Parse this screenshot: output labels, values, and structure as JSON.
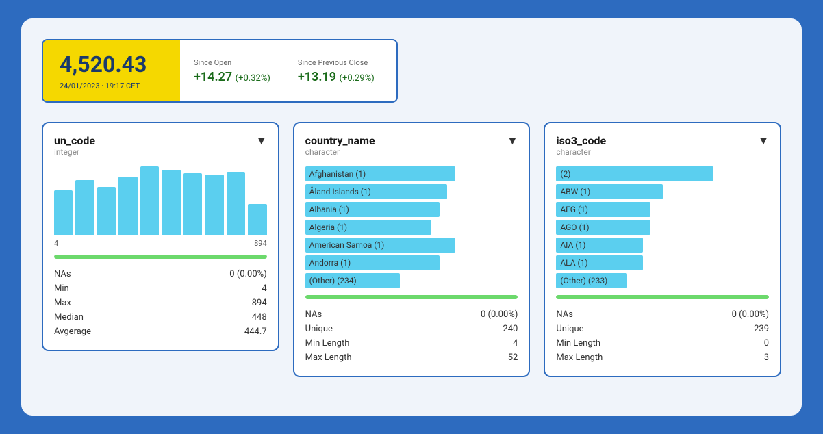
{
  "ticker": {
    "main_value": "4,520.43",
    "date": "24/01/2023 · 19:17 CET",
    "since_open_label": "Since Open",
    "since_open_value": "+14.27",
    "since_open_pct": "(+0.32%)",
    "since_prev_label": "Since Previous Close",
    "since_prev_value": "+13.19",
    "since_prev_pct": "(+0.29%)"
  },
  "card_un_code": {
    "title": "un_code",
    "subtitle": "integer",
    "chevron": "▼",
    "chart_min": "4",
    "chart_max": "894",
    "bars": [
      65,
      80,
      70,
      85,
      100,
      95,
      90,
      88,
      92,
      45
    ],
    "progress_pct": 100,
    "stats": [
      {
        "label": "NAs",
        "value": "0 (0.00%)"
      },
      {
        "label": "Min",
        "value": "4"
      },
      {
        "label": "Max",
        "value": "894"
      },
      {
        "label": "Median",
        "value": "448"
      },
      {
        "label": "Avgerage",
        "value": "444.7"
      }
    ]
  },
  "card_country_name": {
    "title": "country_name",
    "subtitle": "character",
    "chevron": "▼",
    "items": [
      {
        "label": "Afghanistan (1)",
        "width": 95
      },
      {
        "label": "Åland Islands (1)",
        "width": 90
      },
      {
        "label": "Albania (1)",
        "width": 85
      },
      {
        "label": "Algeria (1)",
        "width": 80
      },
      {
        "label": "American Samoa (1)",
        "width": 95
      },
      {
        "label": "Andorra (1)",
        "width": 85
      },
      {
        "label": "(Other) (234)",
        "width": 60
      }
    ],
    "progress_pct": 100,
    "stats": [
      {
        "label": "NAs",
        "value": "0 (0.00%)"
      },
      {
        "label": "Unique",
        "value": "240"
      },
      {
        "label": "Min Length",
        "value": "4"
      },
      {
        "label": "Max Length",
        "value": "52"
      }
    ]
  },
  "card_iso3_code": {
    "title": "iso3_code",
    "subtitle": "character",
    "chevron": "▼",
    "items": [
      {
        "label": "(2)",
        "width": 100
      },
      {
        "label": "ABW (1)",
        "width": 68
      },
      {
        "label": "AFG (1)",
        "width": 60
      },
      {
        "label": "AGO (1)",
        "width": 60
      },
      {
        "label": "AIA (1)",
        "width": 55
      },
      {
        "label": "ALA (1)",
        "width": 55
      },
      {
        "label": "(Other) (233)",
        "width": 45
      }
    ],
    "progress_pct": 100,
    "stats": [
      {
        "label": "NAs",
        "value": "0 (0.00%)"
      },
      {
        "label": "Unique",
        "value": "239"
      },
      {
        "label": "Min Length",
        "value": "0"
      },
      {
        "label": "Max Length",
        "value": "3"
      }
    ]
  }
}
